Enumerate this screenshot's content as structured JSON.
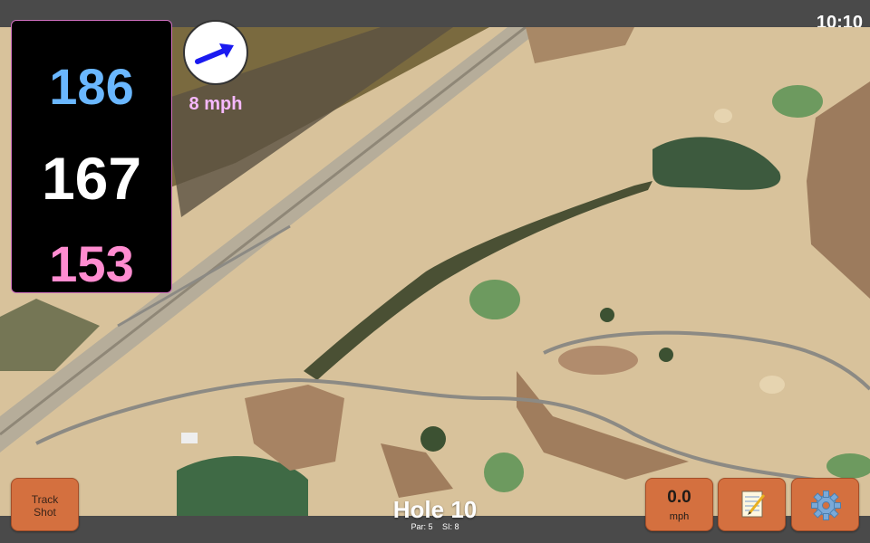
{
  "status_bar": {
    "time": "10:10"
  },
  "distances": {
    "back": "186",
    "middle": "167",
    "front": "153"
  },
  "wind": {
    "label": "8 mph",
    "icon": "wind-direction-arrow-icon"
  },
  "buttons": {
    "track_shot_line1": "Track",
    "track_shot_line2": "Shot",
    "speed_value": "0.0",
    "speed_unit": "mph",
    "notes_icon": "notepad-icon",
    "settings_icon": "gear-icon"
  },
  "hole": {
    "title": "Hole 10",
    "par": "Par: 5",
    "si": "SI: 8"
  },
  "colors": {
    "back_distance": "#6ab7ff",
    "middle_distance": "#ffffff",
    "front_distance": "#ff8cd0",
    "wind_label": "#f6b8ff",
    "button": "#d4703f"
  }
}
